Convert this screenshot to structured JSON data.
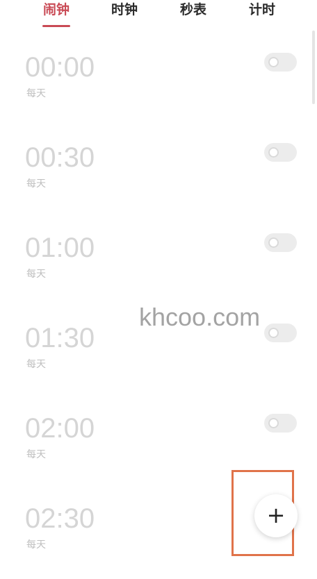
{
  "tabs": [
    {
      "label": "闹钟",
      "active": true
    },
    {
      "label": "时钟",
      "active": false
    },
    {
      "label": "秒表",
      "active": false
    },
    {
      "label": "计时",
      "active": false
    }
  ],
  "alarms": [
    {
      "time": "00:00",
      "repeat": "每天",
      "enabled": false
    },
    {
      "time": "00:30",
      "repeat": "每天",
      "enabled": false
    },
    {
      "time": "01:00",
      "repeat": "每天",
      "enabled": false
    },
    {
      "time": "01:30",
      "repeat": "每天",
      "enabled": false
    },
    {
      "time": "02:00",
      "repeat": "每天",
      "enabled": false
    },
    {
      "time": "02:30",
      "repeat": "每天",
      "enabled": false
    }
  ],
  "watermark": "khcoo.com",
  "add_button": {
    "icon": "plus-icon",
    "label": "+"
  },
  "colors": {
    "accent": "#c94a55",
    "highlight": "#e0734a",
    "time_text": "#d5d5d5",
    "toggle_off": "#ececec"
  }
}
